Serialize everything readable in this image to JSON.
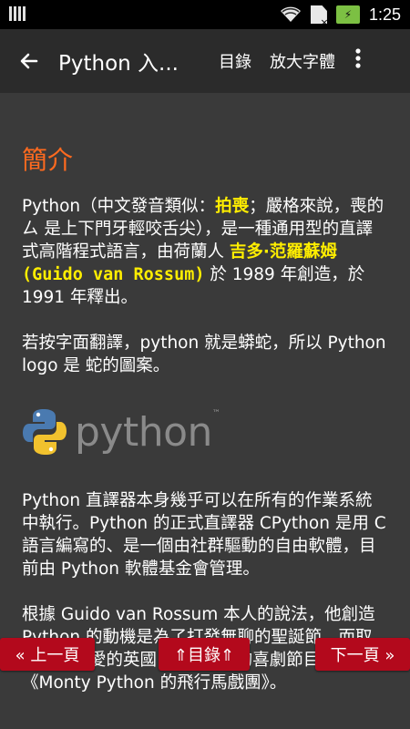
{
  "status_bar": {
    "time": "1:25",
    "battery": "⚡"
  },
  "app_bar": {
    "back_icon": "arrow-left-icon",
    "title": "Python 入...",
    "toc_label": "目錄",
    "zoom_label": "放大字體",
    "overflow_icon": "more-vert-icon"
  },
  "article": {
    "heading": "簡介",
    "p1": {
      "a": "Python（中文發音類似：",
      "b": "拍喪",
      "c": "；嚴格來說，喪的 ㄙ 是上下門牙輕咬舌尖），是一種通用型的直譯式高階程式語言，由荷蘭人 ",
      "d": "吉多·范羅蘇姆",
      "e": "(Guido van Rossum)",
      "f": " 於 1989 年創造，於 1991 年釋出。"
    },
    "p2": "若按字面翻譯，python 就是蟒蛇，所以 Python logo 是 蛇的圖案。",
    "logo_text": "python",
    "logo_tm": "™",
    "p3": "Python 直譯器本身幾乎可以在所有的作業系統中執行。Python 的正式直譯器 CPython 是用 C 語言編寫的、是一個由社群驅動的自由軟體，目前由 Python 軟體基金會管理。",
    "p4": "根據 Guido van Rossum 本人的說法，他創造 Python 的動機是為了打發無聊的聖誕節，而取名自他喜愛的英國 BBC 頻道的喜劇節目《Monty Python 的飛行馬戲團》。"
  },
  "nav": {
    "prev": "« 上一頁",
    "toc": "⇑目錄⇑",
    "next": "下一頁 »"
  },
  "colors": {
    "accent": "#ff6a1f",
    "highlight": "#ffee00",
    "nav_bg": "#b3091c",
    "bg": "#3a3a3a"
  }
}
